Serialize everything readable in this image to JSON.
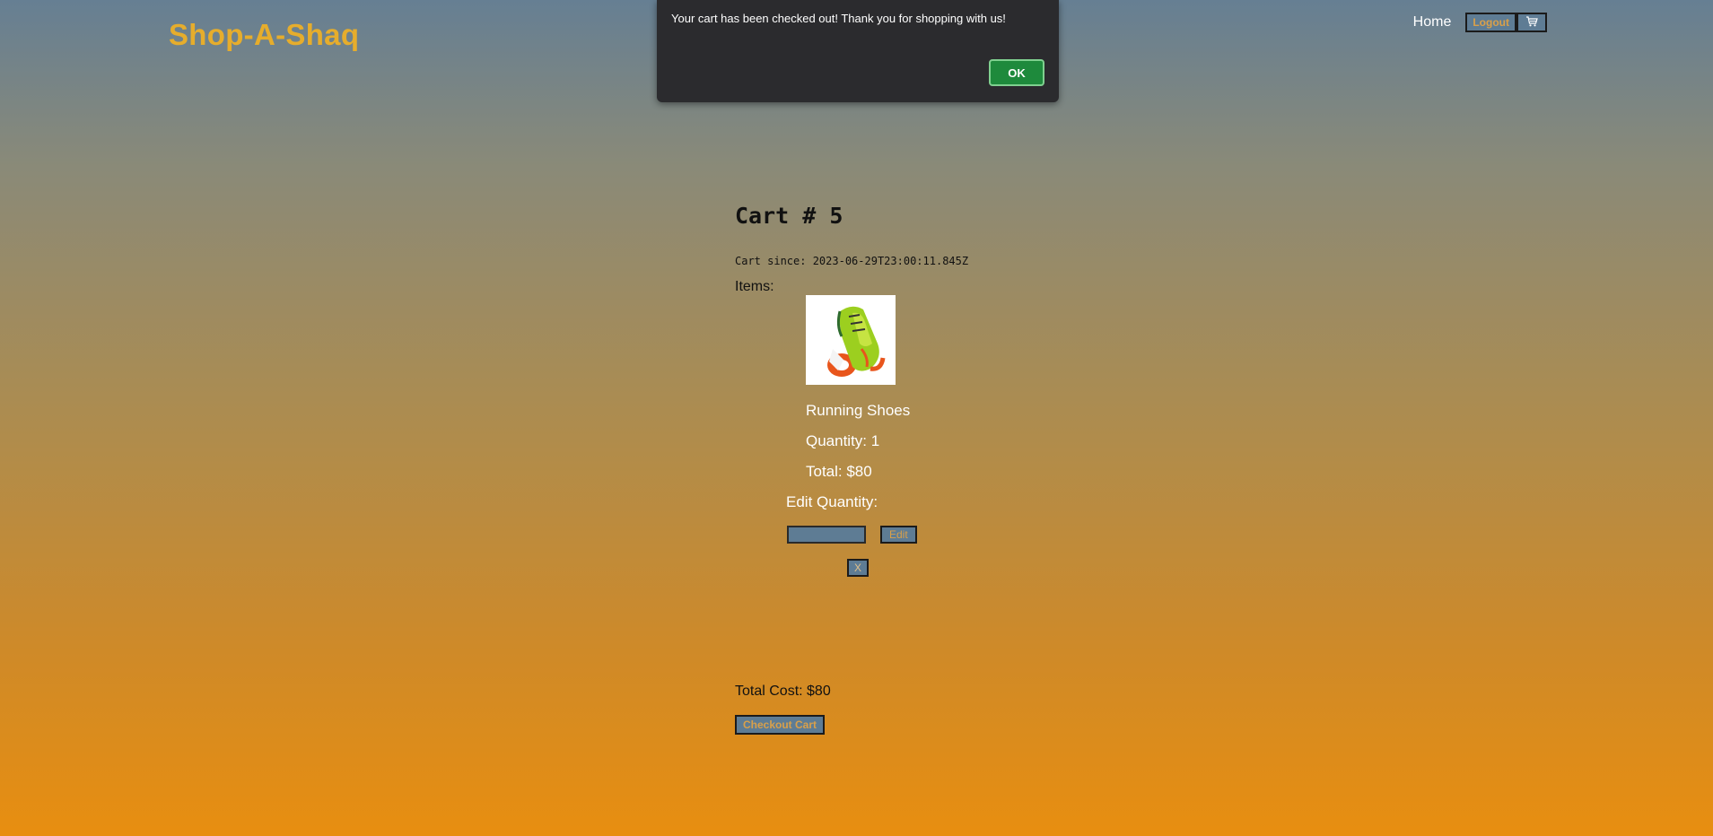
{
  "header": {
    "brand": "Shop-A-Shaq",
    "nav_home": "Home",
    "logout_label": "Logout",
    "cart_icon": "shopping-cart-icon"
  },
  "dialog": {
    "message": "Your cart has been checked out! Thank you for shopping with us!",
    "ok_label": "OK"
  },
  "cart": {
    "title": "Cart # 5",
    "since": "Cart since: 2023-06-29T23:00:11.845Z",
    "items_label": "Items:",
    "items": [
      {
        "name": "Running Shoes",
        "quantity": "Quantity: 1",
        "total": "Total: $80",
        "edit_label": "Edit Quantity:",
        "quantity_value": "",
        "edit_button": "Edit",
        "remove_button": "X"
      }
    ],
    "total_cost": "Total Cost: $80",
    "checkout_label": "Checkout Cart"
  },
  "colors": {
    "brand": "#e6ad2c",
    "button_bg": "#5e7c94",
    "button_text": "#d9a04a",
    "ok_button": "#1e8a3c",
    "dialog_bg": "#2b2b2e"
  }
}
